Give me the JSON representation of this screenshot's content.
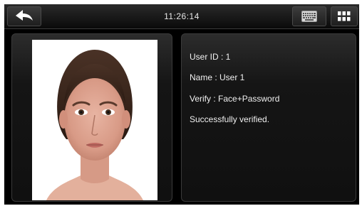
{
  "topbar": {
    "time": "11:26:14",
    "back_icon": "back-arrow-icon",
    "keyboard_icon": "keyboard-icon",
    "menu_icon": "grid-menu-icon"
  },
  "photo": {
    "alt": "User face photo"
  },
  "verification": {
    "user_id": "User ID : 1",
    "name": "Name : User 1",
    "verify": "Verify : Face+Password",
    "status": "Successfully verified."
  },
  "colors": {
    "background": "#000000",
    "text": "#f0f0f0",
    "panel_border": "#3a3a3a"
  }
}
